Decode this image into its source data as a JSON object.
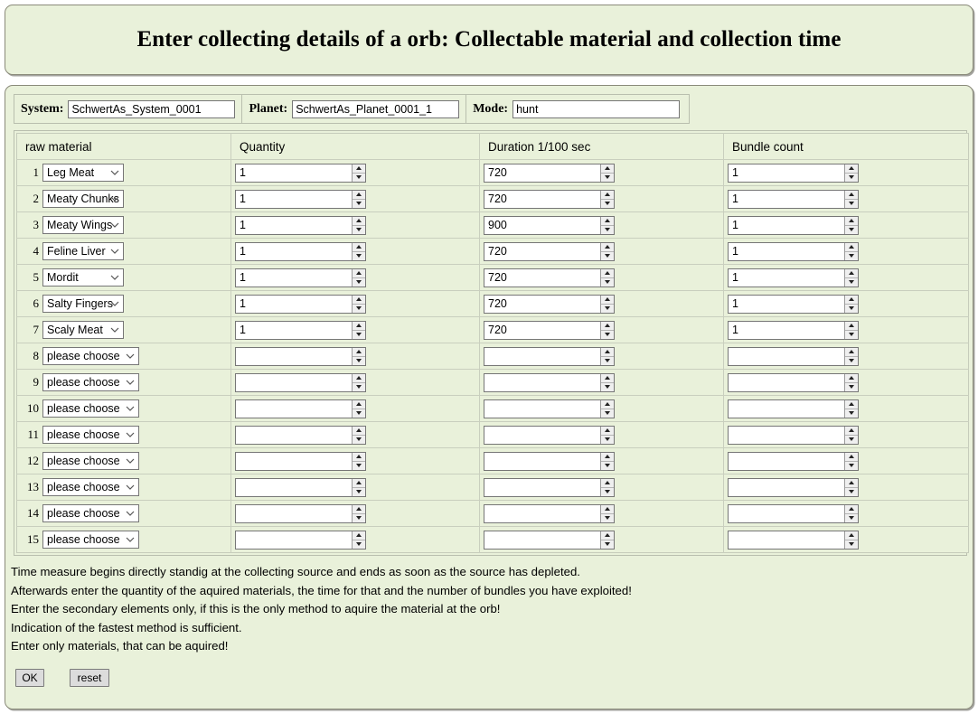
{
  "page": {
    "title": "Enter collecting details of a orb: Collectable material and collection time"
  },
  "meta": {
    "system": {
      "label": "System:",
      "value": "SchwertAs_System_0001"
    },
    "planet": {
      "label": "Planet:",
      "value": "SchwertAs_Planet_0001_1"
    },
    "mode": {
      "label": "Mode:",
      "value": "hunt"
    }
  },
  "table": {
    "headers": {
      "material": "raw material",
      "quantity": "Quantity",
      "duration": "Duration 1/100 sec",
      "bundle": "Bundle count"
    },
    "placeholder_option": "please choose",
    "rows": [
      {
        "n": "1",
        "material": "Leg Meat",
        "quantity": "1",
        "duration": "720",
        "bundle": "1"
      },
      {
        "n": "2",
        "material": "Meaty Chunks",
        "quantity": "1",
        "duration": "720",
        "bundle": "1"
      },
      {
        "n": "3",
        "material": "Meaty Wings",
        "quantity": "1",
        "duration": "900",
        "bundle": "1"
      },
      {
        "n": "4",
        "material": "Feline Liver",
        "quantity": "1",
        "duration": "720",
        "bundle": "1"
      },
      {
        "n": "5",
        "material": "Mordit",
        "quantity": "1",
        "duration": "720",
        "bundle": "1"
      },
      {
        "n": "6",
        "material": "Salty Fingers",
        "quantity": "1",
        "duration": "720",
        "bundle": "1"
      },
      {
        "n": "7",
        "material": "Scaly Meat",
        "quantity": "1",
        "duration": "720",
        "bundle": "1"
      },
      {
        "n": "8",
        "material": "please choose",
        "quantity": "",
        "duration": "",
        "bundle": ""
      },
      {
        "n": "9",
        "material": "please choose",
        "quantity": "",
        "duration": "",
        "bundle": ""
      },
      {
        "n": "10",
        "material": "please choose",
        "quantity": "",
        "duration": "",
        "bundle": ""
      },
      {
        "n": "11",
        "material": "please choose",
        "quantity": "",
        "duration": "",
        "bundle": ""
      },
      {
        "n": "12",
        "material": "please choose",
        "quantity": "",
        "duration": "",
        "bundle": ""
      },
      {
        "n": "13",
        "material": "please choose",
        "quantity": "",
        "duration": "",
        "bundle": ""
      },
      {
        "n": "14",
        "material": "please choose",
        "quantity": "",
        "duration": "",
        "bundle": ""
      },
      {
        "n": "15",
        "material": "please choose",
        "quantity": "",
        "duration": "",
        "bundle": ""
      }
    ]
  },
  "notes": [
    "Time measure begins directly standig at the collecting source and ends as soon as the source has depleted.",
    "Afterwards enter the quantity of the aquired materials, the time for that and the number of bundles you have exploited!",
    "Enter the secondary elements only, if this is the only method to aquire the material at the orb!",
    "Indication of the fastest method is sufficient.",
    "Enter only materials, that can be aquired!"
  ],
  "actions": {
    "ok_label": "OK",
    "reset_label": "reset"
  },
  "colors": {
    "panel_background": "#e9f1da",
    "panel_border": "#8a8a7a",
    "grid_line": "#c9cfbe",
    "input_border": "#767676",
    "button_face": "#dcdcdc"
  }
}
